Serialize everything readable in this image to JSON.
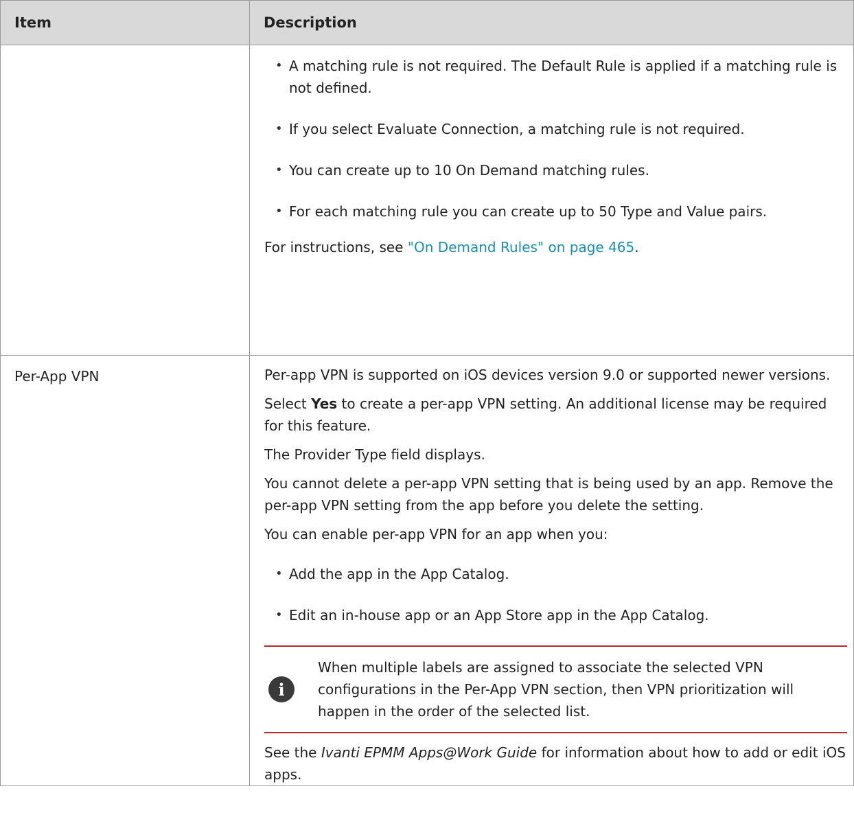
{
  "table": {
    "headers": {
      "item": "Item",
      "description": "Description"
    },
    "row1": {
      "item": "",
      "bullets": [
        "A matching rule is not required. The Default Rule is applied if a matching rule is not defined.",
        "If you select Evaluate Connection, a matching rule is not required.",
        "You can create up to 10 On Demand matching rules.",
        "For each matching rule you can create up to 50 Type and Value pairs."
      ],
      "instructions_prefix": "For instructions, see ",
      "instructions_link": "\"On Demand Rules\" on page 465",
      "instructions_suffix": "."
    },
    "row2": {
      "item": "Per-App VPN",
      "p1": "Per-app VPN is supported on iOS devices version 9.0 or supported newer versions.",
      "p2_prefix": "Select ",
      "p2_bold": "Yes",
      "p2_suffix": " to create a per-app VPN setting. An additional license may be required for this feature.",
      "p3": "The Provider Type field displays.",
      "p4": "You cannot delete a per-app VPN setting that is being used by an app. Remove the per-app VPN setting from the app before you delete the setting.",
      "p5": "You can enable per-app VPN for an app when you:",
      "bullets": [
        "Add the app in the App Catalog.",
        "Edit an in-house app or an App Store app in the App Catalog."
      ],
      "note_icon_glyph": "i",
      "note_text": "When multiple labels are assigned to associate the selected VPN configurations in the Per-App VPN section, then VPN prioritization will happen in the order of the selected list.",
      "see_prefix": "See the ",
      "see_italic": "Ivanti EPMM Apps@Work Guide",
      "see_suffix": " for information about how to add or edit iOS apps."
    }
  }
}
